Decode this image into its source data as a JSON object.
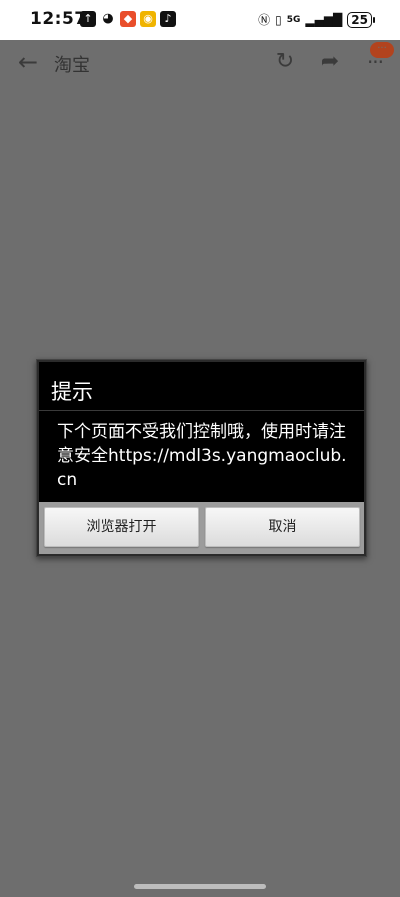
{
  "status_bar": {
    "time": "12:57",
    "battery": "25",
    "network": "5G",
    "notification_icons": [
      "upload-icon",
      "wechat-icon",
      "app-icon",
      "weibo-icon",
      "tiktok-icon"
    ],
    "system_icons": [
      "nfc-icon",
      "vibrate-icon",
      "signal-icon",
      "battery-icon"
    ]
  },
  "toolbar": {
    "title": "淘宝",
    "icons": [
      "back-arrow-icon",
      "refresh-icon",
      "share-icon",
      "more-icon"
    ]
  },
  "dialog": {
    "title": "提示",
    "message": "下个页面不受我们控制哦，使用时请注意安全https://mdl3s.yangmaoclub.cn",
    "open_button": "浏览器打开",
    "cancel_button": "取消"
  },
  "colors": {
    "overlay": "#6e6e6e",
    "dialog_bg": "#000000",
    "button_bar": "#9c9c9c",
    "badge": "#b2431e"
  }
}
